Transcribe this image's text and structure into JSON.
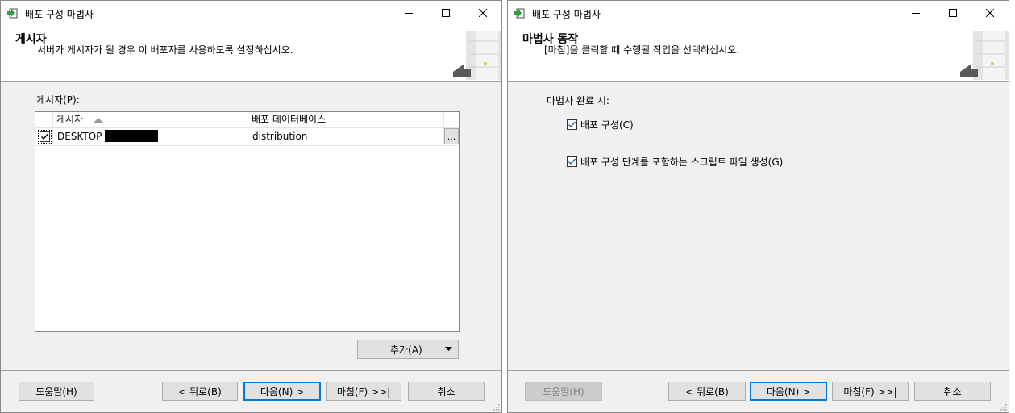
{
  "window1": {
    "title": "배포 구성 마법사",
    "header": {
      "title": "게시자",
      "description": "서버가 게시자가 될 경우 이 배포자를 사용하도록 설정하십시오."
    },
    "publishers_label": "게시자(P):",
    "grid": {
      "columns": [
        "게시자",
        "배포 데이터베이스"
      ],
      "rows": [
        {
          "checked": true,
          "publisher": "DESKTOP",
          "database": "distribution",
          "browse": "..."
        }
      ]
    },
    "add_button": "추가(A)",
    "footer": {
      "help": "도움말(H)",
      "back": "< 뒤로(B)",
      "next": "다음(N) >",
      "finish": "마침(F) >>|",
      "cancel": "취소"
    }
  },
  "window2": {
    "title": "배포 구성 마법사",
    "header": {
      "title": "마법사 동작",
      "description": "[마침]을 클릭할 때 수행될 작업을 선택하십시오."
    },
    "on_complete_label": "마법사 완료 시:",
    "options": [
      {
        "label": "배포 구성(C)",
        "checked": true
      },
      {
        "label": "배포 구성 단계를 포함하는 스크립트 파일 생성(G)",
        "checked": true
      }
    ],
    "footer": {
      "help": "도움말(H)",
      "back": "< 뒤로(B)",
      "next": "다음(N) >",
      "finish": "마침(F) >>|",
      "cancel": "취소"
    }
  },
  "icons": [
    "wizard-app-icon",
    "minimize-icon",
    "maximize-icon",
    "close-icon",
    "server-graphic-icon",
    "sort-ascending-icon",
    "checkbox-checked-icon",
    "dropdown-arrow-icon",
    "resize-grip-icon"
  ],
  "colors": {
    "accent": "#0078d7",
    "checkmark": "#1e5fa8",
    "redacted": "#000000"
  }
}
